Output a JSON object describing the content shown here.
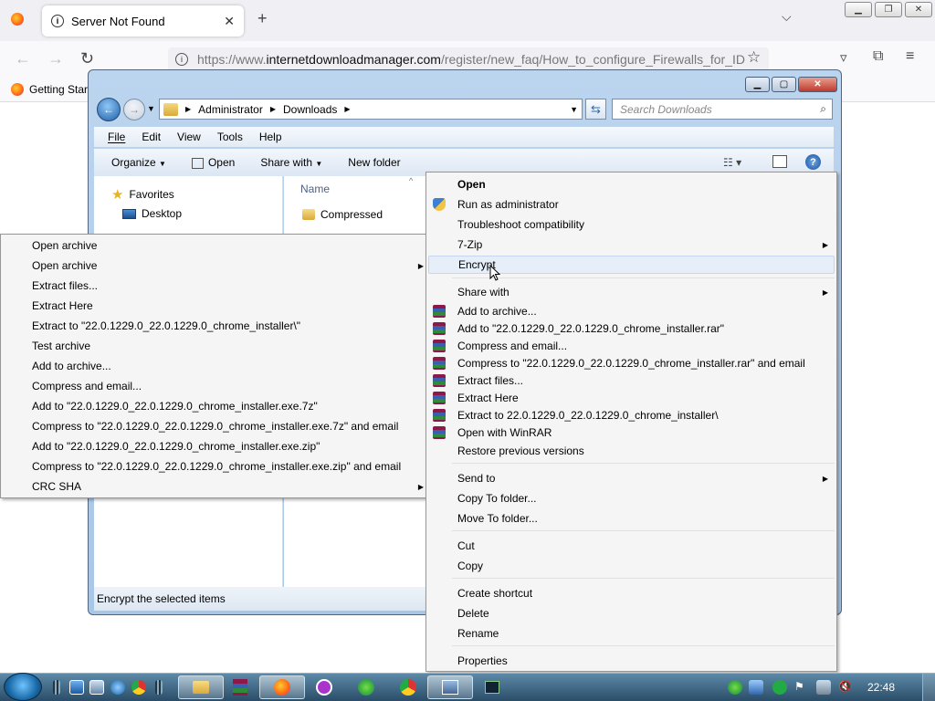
{
  "browser": {
    "tab_title": "Server Not Found",
    "url_prefix": "https://www.",
    "url_host": "internetdownloadmanager.com",
    "url_path": "/register/new_faq/How_to_configure_Firewalls_for_ID",
    "bookmark": "Getting Start"
  },
  "explorer": {
    "breadcrumb": [
      "Administrator",
      "Downloads"
    ],
    "search_placeholder": "Search Downloads",
    "menubar": [
      "File",
      "Edit",
      "View",
      "Tools",
      "Help"
    ],
    "toolbar": {
      "organize": "Organize",
      "open": "Open",
      "share_with": "Share with",
      "new_folder": "New folder"
    },
    "nav": {
      "favorites": "Favorites",
      "desktop": "Desktop"
    },
    "column_name": "Name",
    "files": [
      "Compressed"
    ],
    "status": "Encrypt the selected items"
  },
  "context_menu": [
    {
      "label": "Open",
      "bold": true
    },
    {
      "label": "Run as administrator",
      "icon": "shield-icon"
    },
    {
      "label": "Troubleshoot compatibility"
    },
    {
      "label": "7-Zip",
      "submenu": true
    },
    {
      "label": "Encrypt",
      "highlighted": true
    },
    {
      "label": "Share with",
      "submenu": true
    },
    {
      "label": "Add to archive...",
      "icon": "winrar-icon"
    },
    {
      "label": "Add to \"22.0.1229.0_22.0.1229.0_chrome_installer.rar\"",
      "icon": "winrar-icon"
    },
    {
      "label": "Compress and email...",
      "icon": "winrar-icon"
    },
    {
      "label": "Compress to \"22.0.1229.0_22.0.1229.0_chrome_installer.rar\" and email",
      "icon": "winrar-icon"
    },
    {
      "label": "Extract files...",
      "icon": "winrar-icon"
    },
    {
      "label": "Extract Here",
      "icon": "winrar-icon"
    },
    {
      "label": "Extract to 22.0.1229.0_22.0.1229.0_chrome_installer\\",
      "icon": "winrar-icon"
    },
    {
      "label": "Open with WinRAR",
      "icon": "winrar-icon"
    },
    {
      "label": "Restore previous versions"
    },
    {
      "label": "Send to",
      "submenu": true
    },
    {
      "label": "Copy To folder..."
    },
    {
      "label": "Move To folder..."
    },
    {
      "label": "Cut"
    },
    {
      "label": "Copy"
    },
    {
      "label": "Create shortcut"
    },
    {
      "label": "Delete"
    },
    {
      "label": "Rename"
    },
    {
      "label": "Properties"
    }
  ],
  "zip_submenu": [
    {
      "label": "Open archive"
    },
    {
      "label": "Open archive",
      "submenu": true
    },
    {
      "label": "Extract files..."
    },
    {
      "label": "Extract Here"
    },
    {
      "label": "Extract to \"22.0.1229.0_22.0.1229.0_chrome_installer\\\""
    },
    {
      "label": "Test archive"
    },
    {
      "label": "Add to archive..."
    },
    {
      "label": "Compress and email..."
    },
    {
      "label": "Add to \"22.0.1229.0_22.0.1229.0_chrome_installer.exe.7z\""
    },
    {
      "label": "Compress to \"22.0.1229.0_22.0.1229.0_chrome_installer.exe.7z\" and email"
    },
    {
      "label": "Add to \"22.0.1229.0_22.0.1229.0_chrome_installer.exe.zip\""
    },
    {
      "label": "Compress to \"22.0.1229.0_22.0.1229.0_chrome_installer.exe.zip\" and email"
    },
    {
      "label": "CRC SHA",
      "submenu": true
    }
  ],
  "taskbar": {
    "clock": "22:48"
  },
  "colors": {
    "highlight": "#e6eef9",
    "taskbar": "#2a4d68",
    "menu_bg": "#f5f5f5"
  }
}
